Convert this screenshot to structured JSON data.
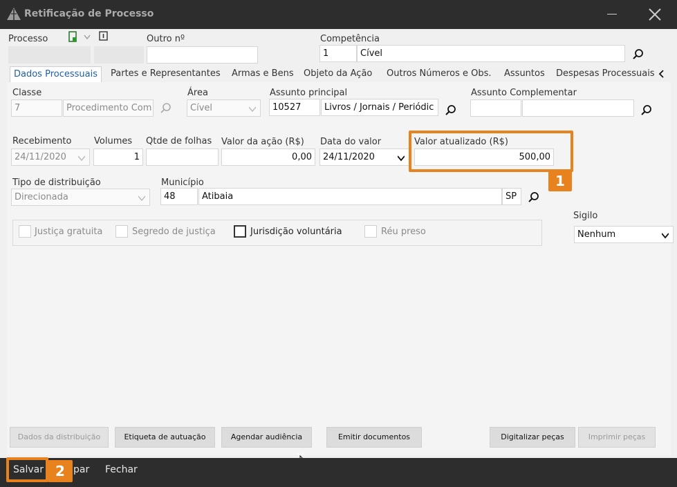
{
  "window": {
    "title": "Retificação de Processo"
  },
  "header": {
    "processo_label": "Processo",
    "outro_label": "Outro nº",
    "competencia_label": "Competência",
    "competencia_code": "1",
    "competencia_value": "Cível"
  },
  "tabs": [
    {
      "label": "Dados Processuais"
    },
    {
      "label": "Partes e Representantes"
    },
    {
      "label": "Armas e Bens"
    },
    {
      "label": "Objeto da Ação"
    },
    {
      "label": "Outros Números e Obs."
    },
    {
      "label": "Assuntos"
    },
    {
      "label": "Despesas Processuais"
    }
  ],
  "form": {
    "classe_label": "Classe",
    "classe_code": "7",
    "classe_value": "Procedimento Com",
    "area_label": "Área",
    "area_value": "Cível",
    "assunto_principal_label": "Assunto principal",
    "assunto_code": "10527",
    "assunto_value": "Livros / Jornais / Periódic",
    "assunto_complementar_label": "Assunto Complementar",
    "recebimento_label": "Recebimento",
    "recebimento_value": "24/11/2020",
    "volumes_label": "Volumes",
    "volumes_value": "1",
    "folhas_label": "Qtde de folhas",
    "valor_acao_label": "Valor da ação (R$)",
    "valor_acao_value": "0,00",
    "data_valor_label": "Data do valor",
    "data_valor_value": "24/11/2020",
    "valor_atualizado_label": "Valor atualizado (R$)",
    "valor_atualizado_value": "500,00",
    "tipo_dist_label": "Tipo de distribuição",
    "tipo_dist_value": "Direcionada",
    "municipio_label": "Município",
    "municipio_code": "48",
    "municipio_value": "Atibaia",
    "municipio_uf": "SP",
    "sigilo_label": "Sigilo",
    "sigilo_value": "Nenhum",
    "checks": {
      "justica_gratuita": "Justiça gratuita",
      "segredo_justica": "Segredo de justiça",
      "jurisdicao_voluntaria": "Jurisdição voluntária",
      "reu_preso": "Réu preso"
    }
  },
  "actions": {
    "dados_distribuicao": "Dados da distribuição",
    "etiqueta": "Etiqueta de autuação",
    "agendar": "Agendar audiência",
    "emitir": "Emitir documentos",
    "digitalizar": "Digitalizar peças",
    "imprimir": "Imprimir peças"
  },
  "footer": {
    "salvar": "Salvar",
    "limpar": "par",
    "fechar": "Fechar"
  },
  "annotations": {
    "badge1": "1",
    "badge2": "2"
  },
  "colors": {
    "accent": "#e8821e",
    "titlebar": "#2d2d2d"
  }
}
